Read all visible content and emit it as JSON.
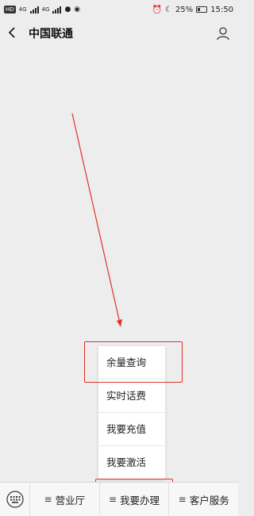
{
  "status": {
    "left_badges": [
      "HD",
      "4G",
      "4G"
    ],
    "battery_percent": "25%",
    "time": "15:50"
  },
  "nav": {
    "title": "中国联通",
    "back_icon": "chevron-left-icon",
    "profile_icon": "person-icon"
  },
  "popup": {
    "items": [
      "余量查询",
      "实时话费",
      "我要充值",
      "我要激活"
    ]
  },
  "bottom_menu": {
    "keyboard_icon": "keyboard-icon",
    "menu_glyph": "≡",
    "items": [
      "营业厅",
      "我要办理",
      "客户服务"
    ]
  },
  "annotation_color": "#e0322b"
}
